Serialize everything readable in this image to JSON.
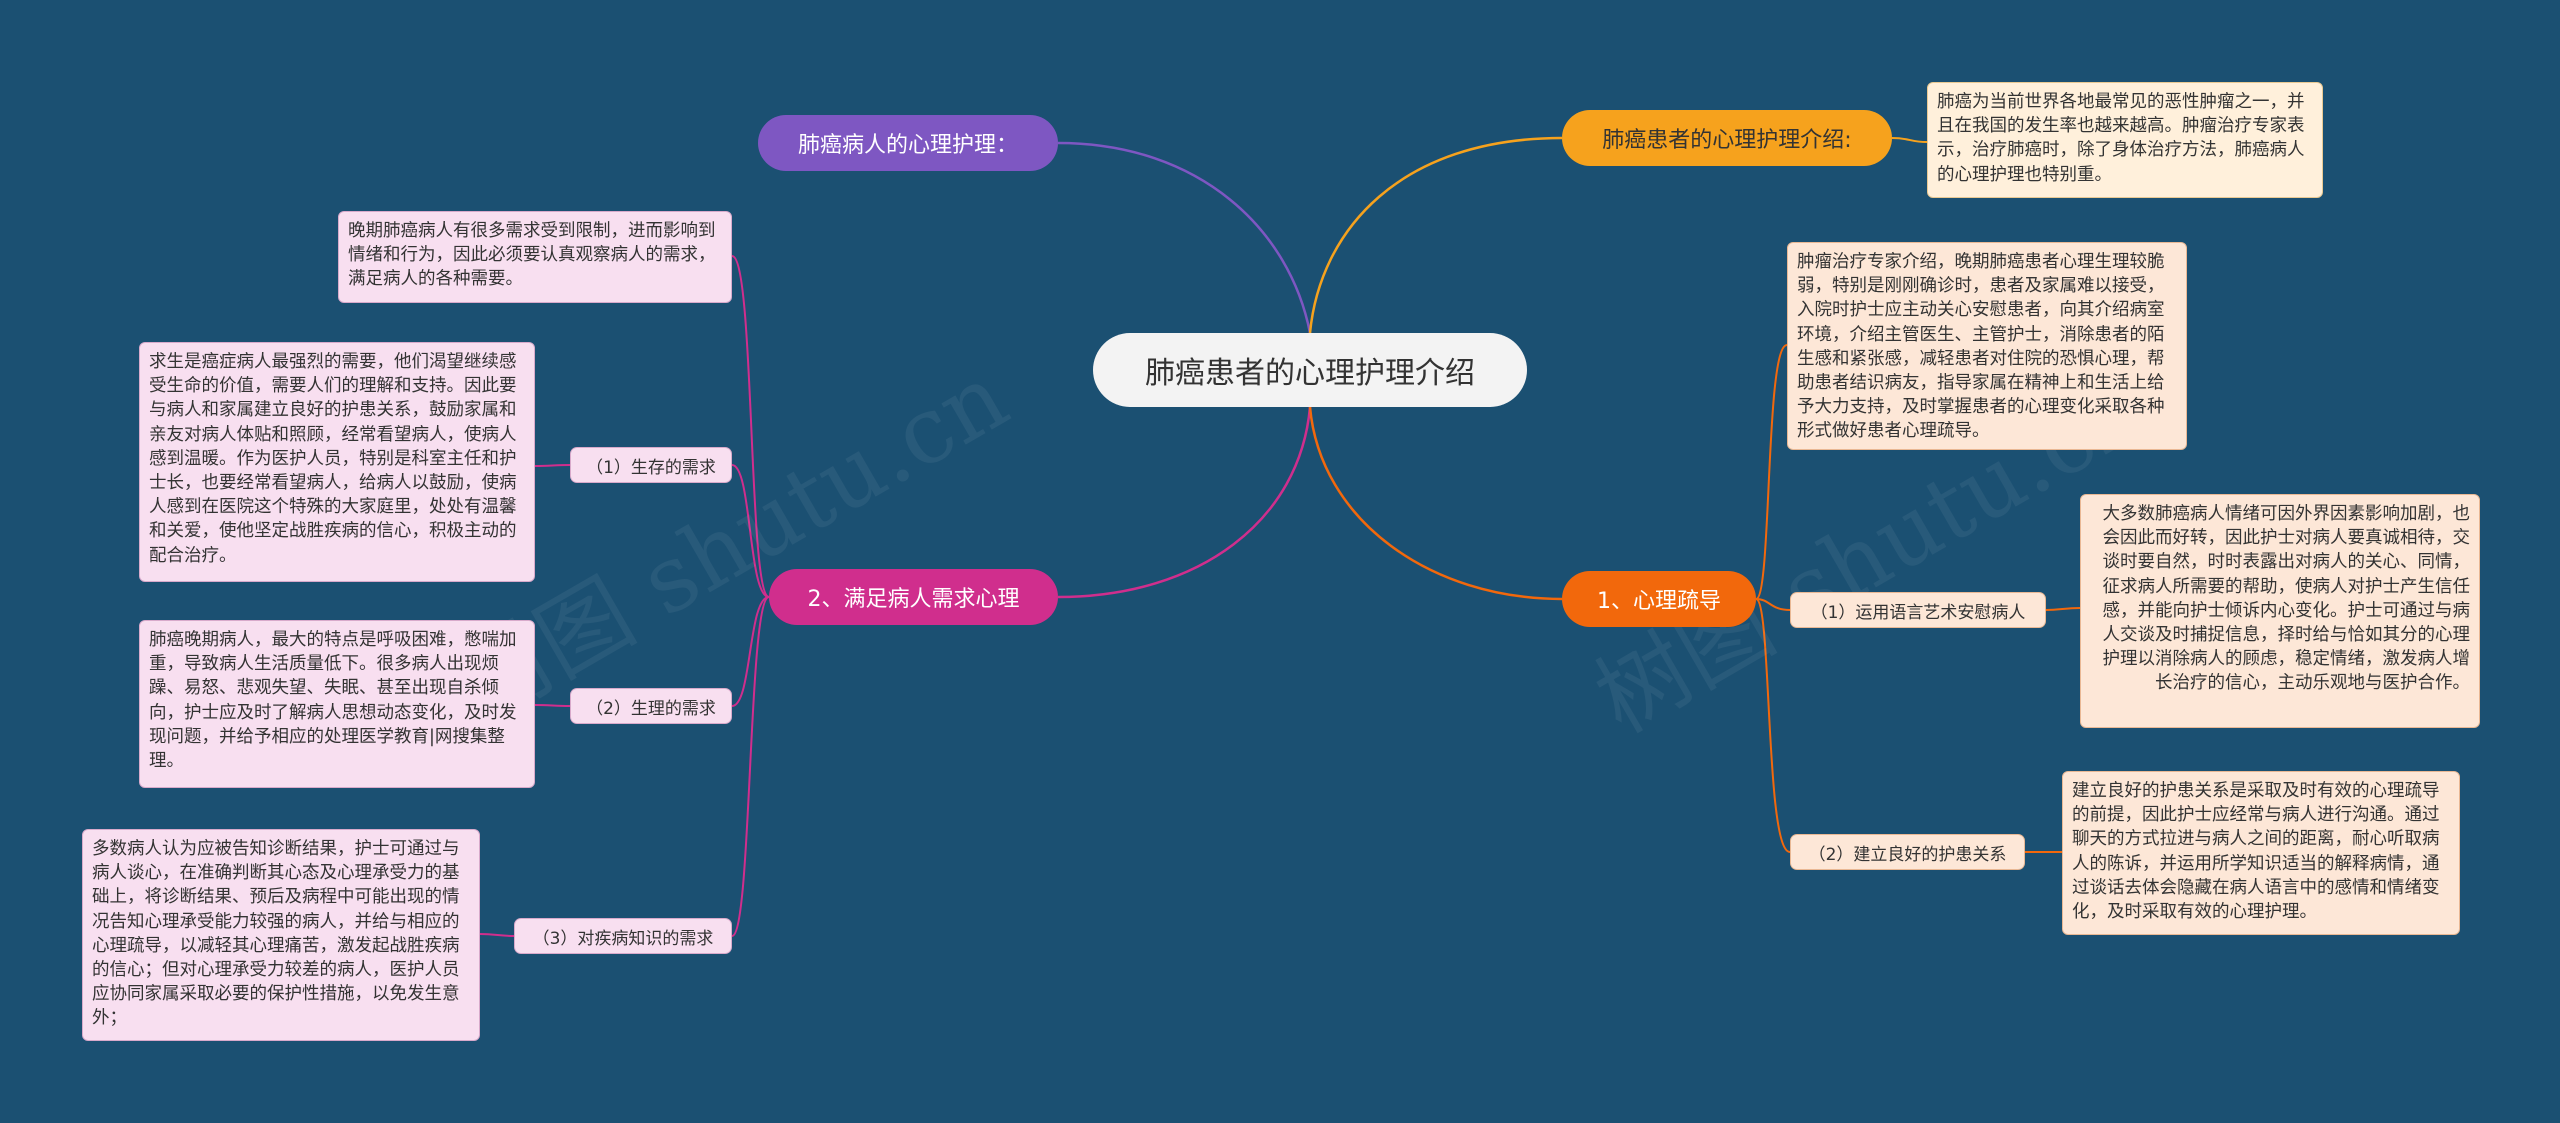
{
  "center": {
    "title": "肺癌患者的心理护理介绍"
  },
  "left_top": {
    "label": "肺癌病人的心理护理："
  },
  "left_main": {
    "label": "2、满足病人需求心理",
    "intro": "晚期肺癌病人有很多需求受到限制，进而影响到情绪和行为，因此必须要认真观察病人的需求，满足病人的各种需要。",
    "children": [
      {
        "label": "（1）生存的需求",
        "text": "求生是癌症病人最强烈的需要，他们渴望继续感受生命的价值，需要人们的理解和支持。因此要与病人和家属建立良好的护患关系，鼓励家属和亲友对病人体贴和照顾，经常看望病人，使病人感到温暖。作为医护人员，特别是科室主任和护士长，也要经常看望病人，给病人以鼓励，使病人感到在医院这个特殊的大家庭里，处处有温馨和关爱，使他坚定战胜疾病的信心，积极主动的配合治疗。"
      },
      {
        "label": "（2）生理的需求",
        "text": "肺癌晚期病人，最大的特点是呼吸困难，憋喘加重，导致病人生活质量低下。很多病人出现烦躁、易怒、悲观失望、失眠、甚至出现自杀倾向，护士应及时了解病人思想动态变化，及时发现问题，并给予相应的处理医学教育|网搜集整理。"
      },
      {
        "label": "（3）对疾病知识的需求",
        "text": "多数病人认为应被告知诊断结果，护士可通过与病人谈心，在准确判断其心态及心理承受力的基础上，将诊断结果、预后及病程中可能出现的情况告知心理承受能力较强的病人，并给与相应的心理疏导，以减轻其心理痛苦，激发起战胜疾病的信心；但对心理承受力较差的病人，医护人员应协同家属采取必要的保护性措施，以免发生意外；"
      }
    ]
  },
  "right_top": {
    "label": "肺癌患者的心理护理介绍:",
    "text": "肺癌为当前世界各地最常见的恶性肿瘤之一，并且在我国的发生率也越来越高。肿瘤治疗专家表示，治疗肺癌时，除了身体治疗方法，肺癌病人的心理护理也特别重。"
  },
  "right_main": {
    "label": "1、心理疏导",
    "intro": "肿瘤治疗专家介绍，晚期肺癌患者心理生理较脆弱，特别是刚刚确诊时，患者及家属难以接受，入院时护士应主动关心安慰患者，向其介绍病室环境，介绍主管医生、主管护士，消除患者的陌生感和紧张感，减轻患者对住院的恐惧心理，帮助患者结识病友，指导家属在精神上和生活上给予大力支持，及时掌握患者的心理变化采取各种形式做好患者心理疏导。",
    "children": [
      {
        "label": "（1）运用语言艺术安慰病人",
        "text": "大多数肺癌病人情绪可因外界因素影响加剧，也会因此而好转，因此护士对病人要真诚相待，交谈时要自然，时时表露出对病人的关心、同情，征求病人所需要的帮助，使病人对护士产生信任感，并能向护士倾诉内心变化。护士可通过与病人交谈及时捕捉信息，择时给与恰如其分的心理护理以消除病人的顾虑，稳定情绪，激发病人增长治疗的信心，主动乐观地与医护合作。"
      },
      {
        "label": "（2）建立良好的护患关系",
        "text": "建立良好的护患关系是采取及时有效的心理疏导的前提，因此护士应经常与病人进行沟通。通过聊天的方式拉进与病人之间的距离，耐心听取病人的陈诉，并运用所学知识适当的解释病情，通过谈话去体会隐藏在病人语言中的感情和情绪变化，及时采取有效的心理护理。"
      }
    ]
  },
  "watermarks": [
    "树图 shutu.cn",
    "树图 shutu.cn"
  ],
  "colors": {
    "background": "#1b5072",
    "purple": "#7e57c2",
    "magenta": "#d02e8d",
    "yellow": "#f6a21d",
    "orange": "#f2680c"
  }
}
